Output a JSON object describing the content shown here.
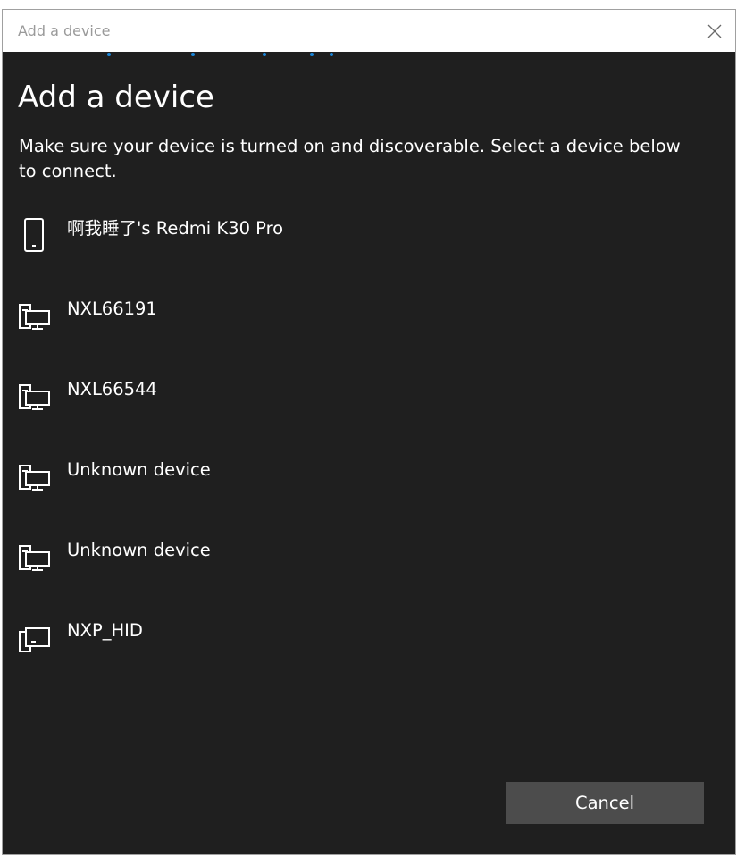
{
  "window": {
    "title": "Add a device"
  },
  "main": {
    "heading": "Add a device",
    "instructions": "Make sure your device is turned on and discoverable. Select a device below to connect."
  },
  "devices": [
    {
      "name": "啊我睡了's Redmi K30 Pro",
      "icon": "phone-icon"
    },
    {
      "name": "NXL66191",
      "icon": "computer-icon"
    },
    {
      "name": "NXL66544",
      "icon": "computer-icon"
    },
    {
      "name": "Unknown device",
      "icon": "computer-icon"
    },
    {
      "name": "Unknown device",
      "icon": "computer-icon"
    },
    {
      "name": "NXP_HID",
      "icon": "input-device-icon"
    }
  ],
  "footer": {
    "cancel_label": "Cancel"
  },
  "colors": {
    "background": "#1f1f1f",
    "button": "#4c4c4c",
    "accent": "#1a86d9",
    "text": "#ffffff"
  }
}
